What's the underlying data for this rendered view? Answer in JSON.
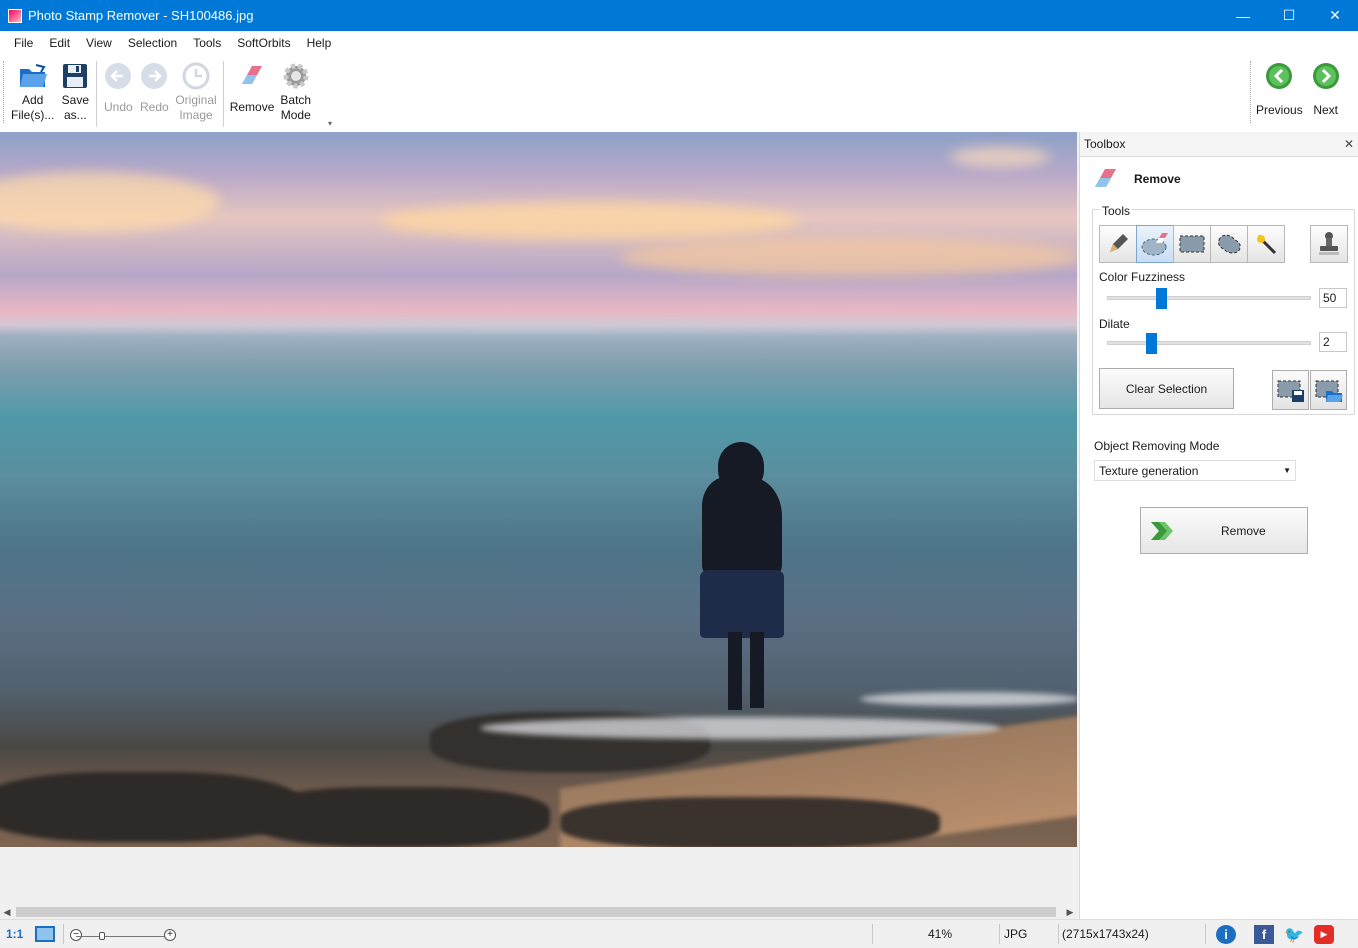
{
  "window": {
    "title": "Photo Stamp Remover - SH100486.jpg",
    "minimize": "—",
    "maximize": "☐",
    "close": "✕"
  },
  "menu": [
    {
      "label": "File",
      "key": "F"
    },
    {
      "label": "Edit",
      "key": "E"
    },
    {
      "label": "View",
      "key": "V"
    },
    {
      "label": "Selection",
      "key": "S"
    },
    {
      "label": "Tools",
      "key": "T"
    },
    {
      "label": "SoftOrbits",
      "key": ""
    },
    {
      "label": "Help",
      "key": "H"
    }
  ],
  "toolbar": {
    "add_files": {
      "line1": "Add",
      "line2": "File(s)..."
    },
    "save_as": {
      "line1": "Save",
      "line2": "as..."
    },
    "undo": "Undo",
    "redo": "Redo",
    "original_image": {
      "line1": "Original",
      "line2": "Image"
    },
    "remove": "Remove",
    "batch_mode": {
      "line1": "Batch",
      "line2": "Mode"
    },
    "previous": "Previous",
    "next": "Next"
  },
  "toolbox": {
    "header": "Toolbox",
    "close": "✕",
    "title": "Remove",
    "tools_label": "Tools",
    "color_fuzziness_label": "Color Fuzziness",
    "color_fuzziness_value": "50",
    "color_fuzziness_fraction": 0.25,
    "dilate_label": "Dilate",
    "dilate_value": "2",
    "dilate_fraction": 0.2,
    "clear_selection": "Clear Selection",
    "mode_label": "Object Removing Mode",
    "mode_value": "Texture generation",
    "remove_button": "Remove"
  },
  "statusbar": {
    "ratio": "1:1",
    "zoom": "41%",
    "format": "JPG",
    "dimensions": "(2715x1743x24)",
    "zoom_minus": "−",
    "zoom_plus": "+"
  },
  "colors": {
    "titlebar": "#0078d7",
    "accent": "#0078d7",
    "nav_green": "#3a9a3a",
    "facebook": "#3b5998",
    "twitter": "#1da1f2",
    "youtube": "#e52d27",
    "info": "#1a6fc2"
  }
}
